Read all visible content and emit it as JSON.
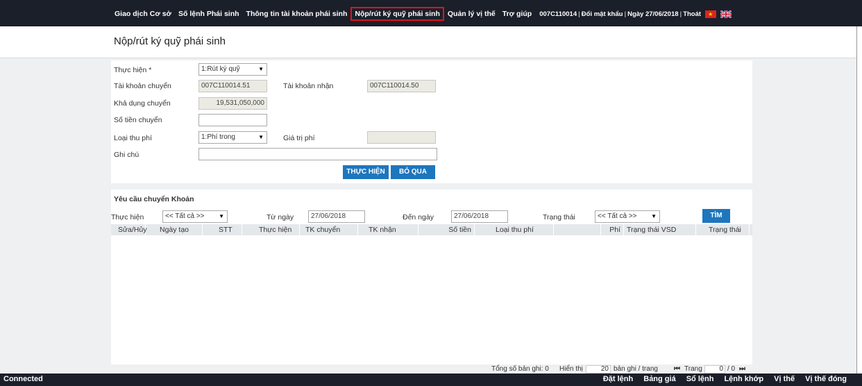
{
  "nav": {
    "items": [
      {
        "label": "Giao dịch Cơ sở",
        "active": false
      },
      {
        "label": "Số lệnh Phái sinh",
        "active": false
      },
      {
        "label": "Thông tin tài khoản phái sinh",
        "active": false
      },
      {
        "label": "Nộp/rút ký quỹ phái sinh",
        "active": true
      },
      {
        "label": "Quản lý vị thế",
        "active": false
      },
      {
        "label": "Trợ giúp",
        "active": false
      }
    ],
    "account": "007C110014",
    "change_password": "Đổi mật khẩu",
    "date": "Ngày 27/06/2018",
    "logout": "Thoát"
  },
  "page": {
    "title": "Nộp/rút ký quỹ phái sinh"
  },
  "form": {
    "action_label": "Thực hiện *",
    "action_value": "1:Rút ký quỹ",
    "from_account_label": "Tài khoản chuyển",
    "from_account_value": "007C110014.51",
    "to_account_label": "Tài khoản nhận",
    "to_account_value": "007C110014.50",
    "available_label": "Khả dụng chuyển",
    "available_value": "19,531,050,000",
    "amount_label": "Số tiền chuyển",
    "amount_value": "",
    "fee_type_label": "Loại thu phí",
    "fee_type_value": "1:Phí trong",
    "fee_value_label": "Giá trị phí",
    "fee_value": "",
    "note_label": "Ghi chú",
    "note_value": "",
    "submit_label": "THỰC HIỆN",
    "cancel_label": "BỎ QUA"
  },
  "requests": {
    "title": "Yêu cầu chuyển Khoản",
    "filter_action_label": "Thực hiện",
    "filter_action_value": "<< Tất cả >>",
    "from_date_label": "Từ ngày",
    "from_date_value": "27/06/2018",
    "to_date_label": "Đến ngày",
    "to_date_value": "27/06/2018",
    "status_label": "Trạng thái",
    "status_value": "<< Tất cả >>",
    "search_label": "TÌM",
    "columns": [
      "Sửa/Hủy",
      "Ngày tạo",
      "STT",
      "Thực hiện",
      "TK chuyển",
      "TK nhận",
      "Số tiền",
      "Loại thu phí",
      "",
      "Phí",
      "Trạng thái VSD",
      "Trạng thái"
    ],
    "total_label": "Tổng số bản ghi: 0",
    "show_label": "Hiển thị",
    "page_size": "20",
    "per_page_label": "bản ghi / trang",
    "page_label": "Trang",
    "page_current": "0",
    "page_total": "/ 0"
  },
  "status": {
    "connection": "Connected",
    "bottom_nav": [
      "Đặt lệnh",
      "Bảng giá",
      "Sổ lệnh",
      "Lệnh khớp",
      "Vị thế",
      "Vị thế đóng"
    ]
  }
}
